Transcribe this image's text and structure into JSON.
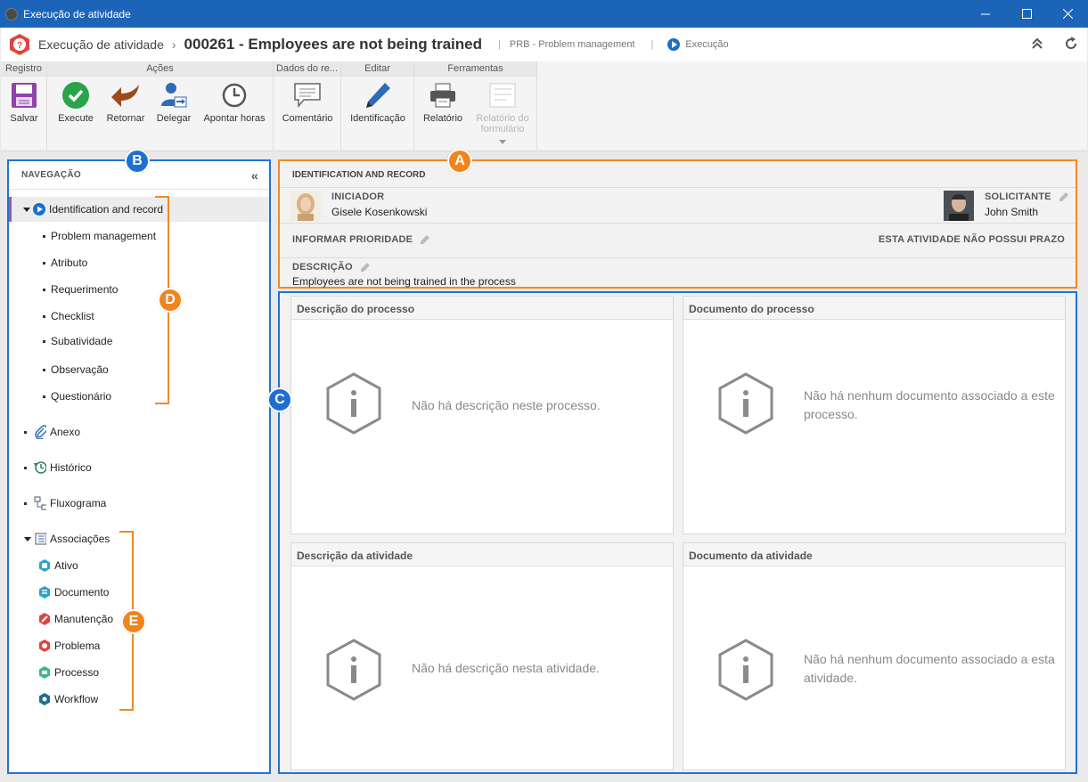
{
  "window": {
    "title": "Execução de atividade"
  },
  "header": {
    "crumb": "Execução de atividade",
    "separator": "›",
    "title": "000261 - Employees are not being trained",
    "pipe1": "|",
    "category": "PRB - Problem management",
    "pipe2": "|",
    "status": "Execução"
  },
  "ribbon": {
    "groups": [
      {
        "title": "Registro"
      },
      {
        "title": "Ações"
      },
      {
        "title": "Dados do re..."
      },
      {
        "title": "Editar"
      },
      {
        "title": "Ferramentas"
      }
    ],
    "buttons": {
      "save": "Salvar",
      "execute": "Execute",
      "return": "Retornar",
      "delegate": "Delegar",
      "log_hours": "Apontar horas",
      "comment": "Comentário",
      "identification": "Identificação",
      "report": "Relatório",
      "form_report": "Relatório do formulário"
    }
  },
  "nav": {
    "title": "NAVEGAÇÃO",
    "collapse": "«",
    "root": "Identification and record",
    "sub_items": [
      "Problem management",
      "Atributo",
      "Requerimento",
      "Checklist",
      "Subatividade",
      "Observação",
      "Questionário"
    ],
    "attachment": "Anexo",
    "history": "Histórico",
    "flowchart": "Fluxograma",
    "associations": "Associações",
    "assoc_items": [
      "Ativo",
      "Documento",
      "Manutenção",
      "Problema",
      "Processo",
      "Workflow"
    ]
  },
  "identification": {
    "section_title": "IDENTIFICATION AND RECORD",
    "initiator_label": "INICIADOR",
    "initiator_name": "Gisele Kosenkowski",
    "requester_label": "SOLICITANTE",
    "requester_name": "John Smith",
    "priority_label": "INFORMAR PRIORIDADE",
    "deadline_text": "ESTA ATIVIDADE NÃO POSSUI PRAZO",
    "description_label": "DESCRIÇÃO",
    "description_value": "Employees are not being trained in the process"
  },
  "cards": [
    {
      "title": "Descrição do processo",
      "message": "Não há descrição neste processo."
    },
    {
      "title": "Documento do processo",
      "message": "Não há nenhum documento associado a este processo."
    },
    {
      "title": "Descrição da atividade",
      "message": "Não há descrição nesta atividade."
    },
    {
      "title": "Documento da atividade",
      "message": "Não há nenhum documento associado a esta atividade."
    }
  ],
  "callouts": {
    "a": "A",
    "b": "B",
    "c": "C",
    "d": "D",
    "e": "E"
  },
  "colors": {
    "titlebar": "#1c64b8",
    "highlight_orange": "#f08a24",
    "highlight_blue": "#2173d3",
    "active_marker": "#9b59b6"
  }
}
